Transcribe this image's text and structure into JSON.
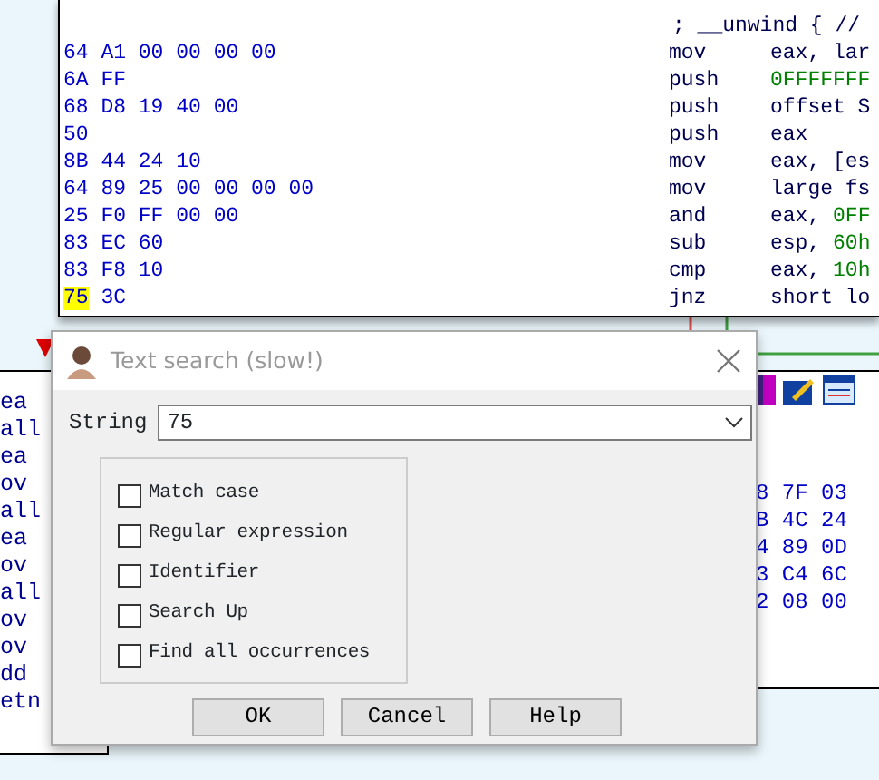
{
  "disassembly": {
    "lines": [
      {
        "comment": "; __unwind { //"
      },
      {
        "bytes": "64 A1 00 00 00 00",
        "mnemonic": "mov",
        "operands": [
          {
            "text": "eax, lar"
          }
        ]
      },
      {
        "bytes": "6A FF",
        "mnemonic": "push",
        "operands": [
          {
            "text": "0FFFFFFF",
            "kind": "number"
          }
        ]
      },
      {
        "bytes": "68 D8 19 40 00",
        "mnemonic": "push",
        "operands": [
          {
            "text": "offset S"
          }
        ]
      },
      {
        "bytes": "50",
        "mnemonic": "push",
        "operands": [
          {
            "text": "eax"
          }
        ]
      },
      {
        "bytes": "8B 44 24 10",
        "mnemonic": "mov",
        "operands": [
          {
            "text": "eax, [es"
          }
        ]
      },
      {
        "bytes": "64 89 25 00 00 00 00",
        "mnemonic": "mov",
        "operands": [
          {
            "text": "large fs"
          }
        ]
      },
      {
        "bytes": "25 F0 FF 00 00",
        "mnemonic": "and",
        "operands": [
          {
            "text": "eax, "
          },
          {
            "text": "0FF",
            "kind": "number"
          }
        ]
      },
      {
        "bytes": "83 EC 60",
        "mnemonic": "sub",
        "operands": [
          {
            "text": "esp, "
          },
          {
            "text": "60h",
            "kind": "number"
          }
        ]
      },
      {
        "bytes": "83 F8 10",
        "mnemonic": "cmp",
        "operands": [
          {
            "text": "eax, "
          },
          {
            "text": "10h",
            "kind": "number"
          }
        ]
      },
      {
        "highlighted_bytes": "75",
        "bytes": "3C",
        "mnemonic": "jnz",
        "operands": [
          {
            "text": "short lo"
          }
        ]
      }
    ]
  },
  "left_listing": [
    "ea",
    "all",
    "ea",
    "ov",
    "all",
    "ea",
    "ov",
    "all",
    "ov",
    "ov",
    "dd",
    "etn"
  ],
  "hex_panel": [
    "8 7F 03",
    "B 4C 24",
    "4 89 0D",
    "3 C4 6C",
    "2 08 00"
  ],
  "dialog": {
    "title": "Text search (slow!)",
    "string_field": {
      "label": "String",
      "value": "75"
    },
    "options": [
      {
        "label": "Match case",
        "checked": false
      },
      {
        "label": "Regular expression",
        "checked": false
      },
      {
        "label": "Identifier",
        "checked": false
      },
      {
        "label": "Search Up",
        "checked": false
      },
      {
        "label": "Find all occurrences",
        "checked": false
      }
    ],
    "buttons": [
      "OK",
      "Cancel",
      "Help"
    ]
  }
}
